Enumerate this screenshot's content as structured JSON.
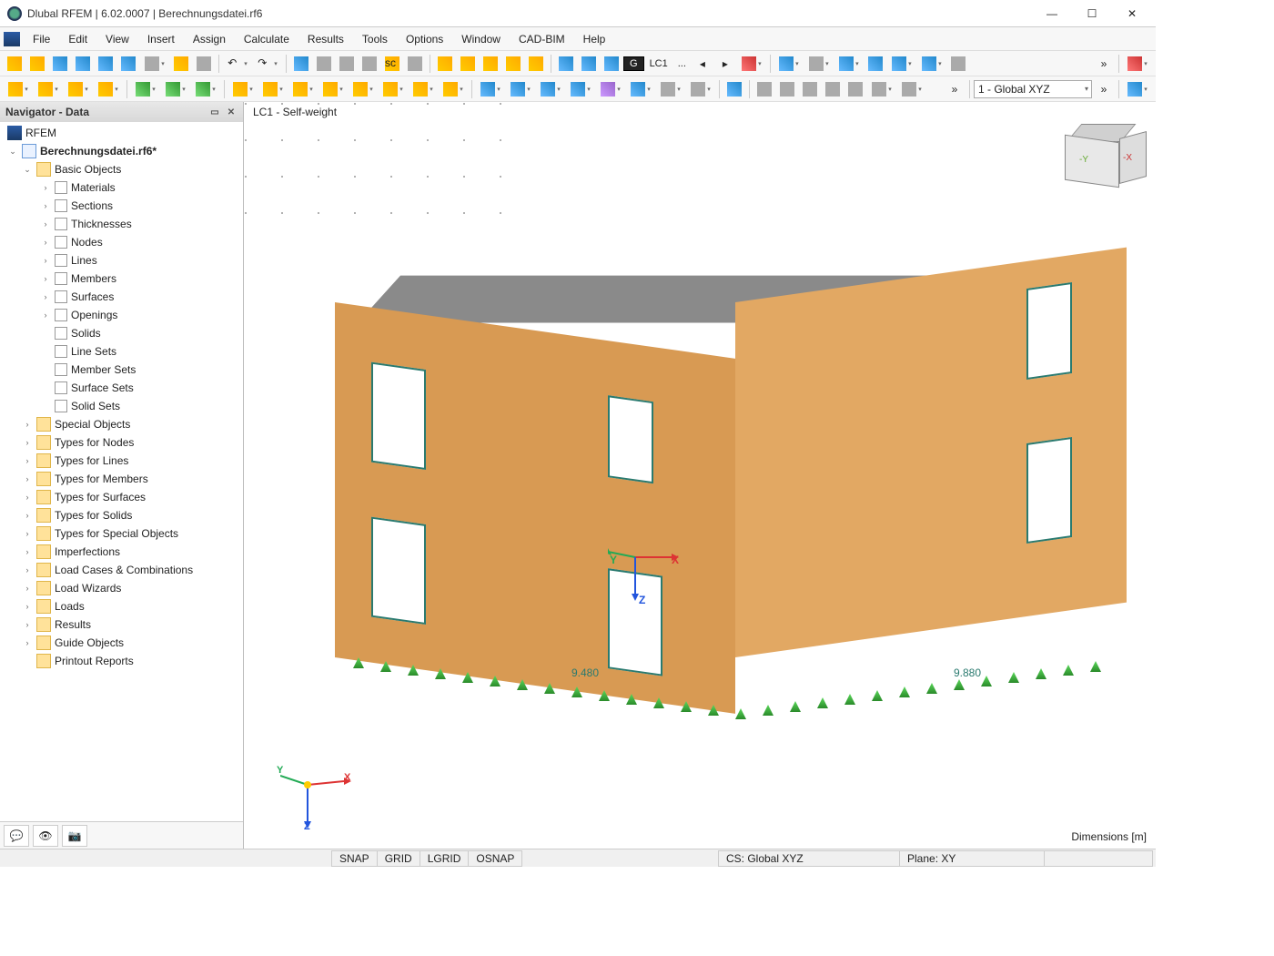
{
  "window": {
    "title": "Dlubal RFEM | 6.02.0007 | Berechnungsdatei.rf6"
  },
  "menu": [
    "File",
    "Edit",
    "View",
    "Insert",
    "Assign",
    "Calculate",
    "Results",
    "Tools",
    "Options",
    "Window",
    "CAD-BIM",
    "Help"
  ],
  "navigator": {
    "title": "Navigator - Data",
    "root": "RFEM",
    "file": "Berechnungsdatei.rf6*",
    "basic": "Basic Objects",
    "basic_children": [
      "Materials",
      "Sections",
      "Thicknesses",
      "Nodes",
      "Lines",
      "Members",
      "Surfaces",
      "Openings",
      "Solids",
      "Line Sets",
      "Member Sets",
      "Surface Sets",
      "Solid Sets"
    ],
    "folders": [
      "Special Objects",
      "Types for Nodes",
      "Types for Lines",
      "Types for Members",
      "Types for Surfaces",
      "Types for Solids",
      "Types for Special Objects",
      "Imperfections",
      "Load Cases & Combinations",
      "Load Wizards",
      "Loads",
      "Results",
      "Guide Objects",
      "Printout Reports"
    ]
  },
  "viewport": {
    "label": "LC1 - Self-weight",
    "dim_left": "9.480",
    "dim_right": "9.880",
    "dimensions_lbl": "Dimensions [m]",
    "axes": {
      "x": "X",
      "y": "Y",
      "z": "Z"
    },
    "cube": {
      "x": "-X",
      "y": "-Y"
    }
  },
  "loadcase": {
    "pill": "G",
    "name": "LC1",
    "dots": "..."
  },
  "cs_combo": "1 - Global XYZ",
  "status": {
    "snap": "SNAP",
    "grid": "GRID",
    "lgrid": "LGRID",
    "osnap": "OSNAP",
    "cs": "CS: Global XYZ",
    "plane": "Plane: XY"
  }
}
